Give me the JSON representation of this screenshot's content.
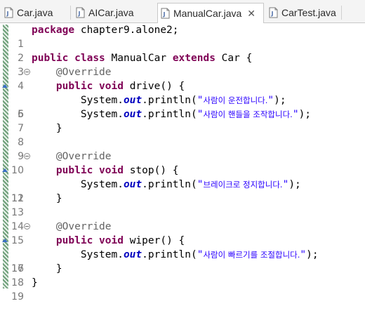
{
  "tabs": [
    {
      "label": "Car.java",
      "active": false
    },
    {
      "label": "AICar.java",
      "active": false
    },
    {
      "label": "ManualCar.java",
      "active": true,
      "close_glyph": "✕"
    },
    {
      "label": "CarTest.java",
      "active": false
    }
  ],
  "code": {
    "package_kw": "package",
    "package_name": " chapter9.alone2;",
    "class_decl": {
      "public": "public",
      "class": "class",
      "name": " ManualCar ",
      "extends": "extends",
      "parent": " Car {"
    },
    "annotation": "@Override",
    "methods": [
      {
        "sig_public": "public",
        "sig_void": "void",
        "sig_rest": " drive() {",
        "prints": [
          {
            "pre": "System.",
            "field": "out",
            "mid": ".println(",
            "q1": "\"",
            "text": "사람이 운전합니다.",
            "q2": "\"",
            "end": ");"
          },
          {
            "pre": "System.",
            "field": "out",
            "mid": ".println(",
            "q1": "\"",
            "text": "사람이 핸들을 조작합니다.",
            "q2": "\"",
            "end": ");"
          }
        ]
      },
      {
        "sig_public": "public",
        "sig_void": "void",
        "sig_rest": " stop() {",
        "prints": [
          {
            "pre": "System.",
            "field": "out",
            "mid": ".println(",
            "q1": "\"",
            "text": "브레이크로 정지합니다.",
            "q2": "\"",
            "end": ");"
          }
        ]
      },
      {
        "sig_public": "public",
        "sig_void": "void",
        "sig_rest": " wiper() {",
        "prints": [
          {
            "pre": "System.",
            "field": "out",
            "mid": ".println(",
            "q1": "\"",
            "text": "사람이 빠르기를 조절합니다.",
            "q2": "\"",
            "end": ");"
          }
        ]
      }
    ],
    "close_brace": "}",
    "line_numbers": [
      "1",
      "2",
      "3",
      "4",
      "5",
      "6",
      "7",
      "8",
      "9",
      "10",
      "11",
      "12",
      "13",
      "14",
      "15",
      "16",
      "17",
      "18",
      "19"
    ]
  },
  "icons": {
    "java_file": "java-file-icon",
    "fold": "fold-toggle-icon",
    "override": "override-marker-icon"
  },
  "colors": {
    "keyword": "#7f0055",
    "annotation": "#646464",
    "field": "#0000c0",
    "string": "#2a00ff",
    "line_number": "#787878"
  }
}
